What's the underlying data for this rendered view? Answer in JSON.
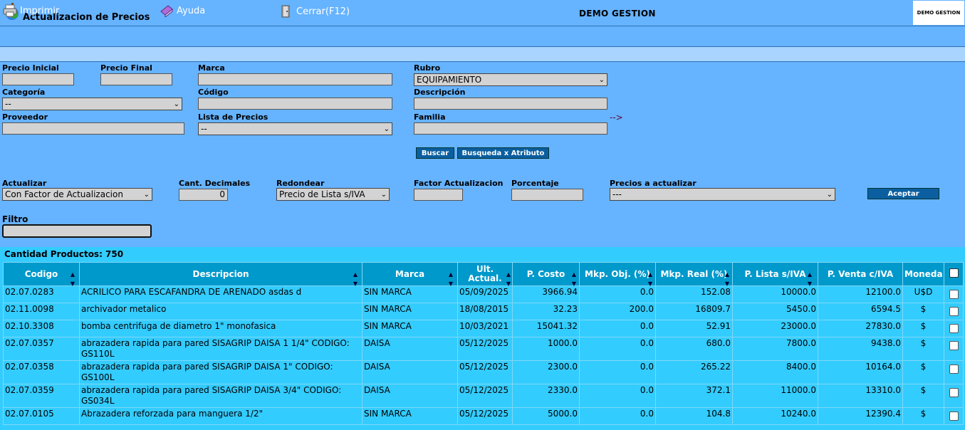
{
  "window": {
    "title": "Actualizacion de Precios",
    "company": "DEMO GESTION",
    "company_box": "DEMO GESTION"
  },
  "toolbar": {
    "print": "Imprimir",
    "help": "Ayuda",
    "close": "Cerrar(F12)"
  },
  "filters": {
    "precio_inicial": {
      "label": "Precio Inicial",
      "value": ""
    },
    "precio_final": {
      "label": "Precio Final",
      "value": ""
    },
    "marca": {
      "label": "Marca",
      "value": ""
    },
    "rubro": {
      "label": "Rubro",
      "value": "EQUIPAMIENTO"
    },
    "categoria": {
      "label": "Categoría",
      "value": "--"
    },
    "codigo": {
      "label": "Código",
      "value": ""
    },
    "descripcion": {
      "label": "Descripción",
      "value": ""
    },
    "proveedor": {
      "label": "Proveedor",
      "value": ""
    },
    "lista_precios": {
      "label": "Lista de Precios",
      "value": "--"
    },
    "familia": {
      "label": "Familia",
      "value": ""
    },
    "familia_arrow": "-->",
    "buscar": "Buscar",
    "busqueda_atributo": "Busqueda x Atributo"
  },
  "update": {
    "actualizar": {
      "label": "Actualizar",
      "value": "Con Factor de Actualizacion"
    },
    "decimales": {
      "label": "Cant. Decimales",
      "value": "0"
    },
    "redondear": {
      "label": "Redondear",
      "value": "Precio de Lista s/IVA"
    },
    "factor": {
      "label": "Factor Actualizacion",
      "value": ""
    },
    "porcentaje": {
      "label": "Porcentaje",
      "value": ""
    },
    "precios": {
      "label": "Precios a actualizar",
      "value": "---"
    },
    "aceptar": "Aceptar",
    "filtro": {
      "label": "Filtro",
      "value": ""
    }
  },
  "grid": {
    "count_label": "Cantidad Productos: 750",
    "headers": [
      "Codigo",
      "Descripcion",
      "Marca",
      "Ult. Actual.",
      "P. Costo",
      "Mkp. Obj. (%)",
      "Mkp. Real (%)",
      "P. Lista s/IVA",
      "P. Venta c/IVA",
      "Moneda"
    ],
    "rows": [
      [
        "02.07.0283",
        "ACRILICO PARA ESCAFANDRA DE ARENADO asdas d",
        "SIN MARCA",
        "05/09/2025",
        "3966.94",
        "0.0",
        "152.08",
        "10000.0",
        "12100.0",
        "U$D"
      ],
      [
        "02.11.0098",
        "archivador metalico",
        "SIN MARCA",
        "18/08/2015",
        "32.23",
        "200.0",
        "16809.7",
        "5450.0",
        "6594.5",
        "$"
      ],
      [
        "02.10.3308",
        "bomba centrifuga de diametro 1\" monofasica",
        "SIN MARCA",
        "10/03/2021",
        "15041.32",
        "0.0",
        "52.91",
        "23000.0",
        "27830.0",
        "$"
      ],
      [
        "02.07.0357",
        "abrazadera rapida para pared SISAGRIP DAISA 1 1/4\" CODIGO: GS110L",
        "DAISA",
        "05/12/2025",
        "1000.0",
        "0.0",
        "680.0",
        "7800.0",
        "9438.0",
        "$"
      ],
      [
        "02.07.0358",
        "abrazadera rapida para pared SISAGRIP DAISA 1\" CODIGO: GS100L",
        "DAISA",
        "05/12/2025",
        "2300.0",
        "0.0",
        "265.22",
        "8400.0",
        "10164.0",
        "$"
      ],
      [
        "02.07.0359",
        "abrazadera rapida para pared SISAGRIP DAISA 3/4\" CODIGO: GS034L",
        "DAISA",
        "05/12/2025",
        "2330.0",
        "0.0",
        "372.1",
        "11000.0",
        "13310.0",
        "$"
      ],
      [
        "02.07.0105",
        "Abrazadera reforzada para manguera 1/2\"",
        "SIN MARCA",
        "05/12/2025",
        "5000.0",
        "0.0",
        "104.8",
        "10240.0",
        "12390.4",
        "$"
      ]
    ]
  }
}
